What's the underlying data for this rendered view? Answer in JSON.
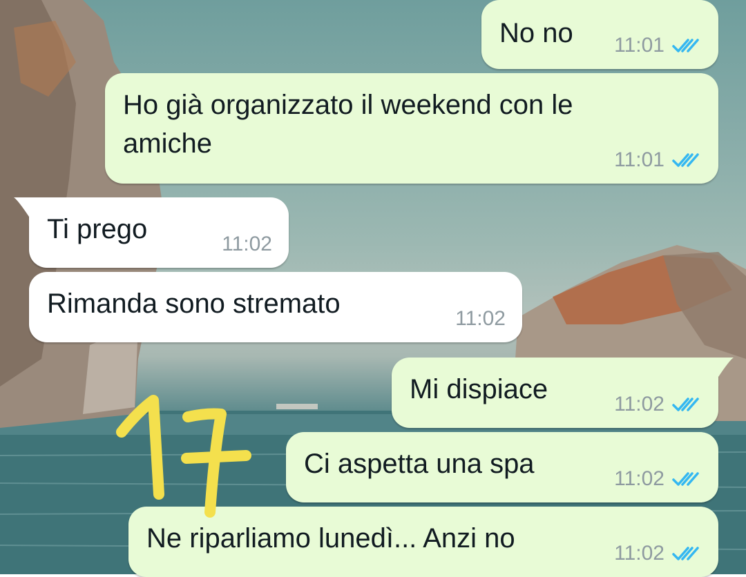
{
  "colors": {
    "outgoing_bubble": "#e8fbd6",
    "incoming_bubble": "#ffffff",
    "read_ticks": "#34b7f1",
    "timestamp": "#8e9aa0",
    "annotation": "#f4e04d"
  },
  "icons": {
    "read_receipt": "double-check-icon"
  },
  "messages": [
    {
      "direction": "out",
      "text": "No no",
      "time": "11:01",
      "status": "read"
    },
    {
      "direction": "out",
      "text": "Ho già organizzato il weekend con le\namiche",
      "time": "11:01",
      "status": "read"
    },
    {
      "direction": "in",
      "text": "Ti prego",
      "time": "11:02"
    },
    {
      "direction": "in",
      "text": "Rimanda sono stremato",
      "time": "11:02"
    },
    {
      "direction": "out",
      "text": "Mi dispiace",
      "time": "11:02",
      "status": "read"
    },
    {
      "direction": "out",
      "text": "Ci aspetta una spa",
      "time": "11:02",
      "status": "read"
    },
    {
      "direction": "out",
      "text": "Ne riparliamo lunedì... Anzi no",
      "time": "11:02",
      "status": "read"
    }
  ],
  "annotation": {
    "handwritten_text": "17"
  }
}
